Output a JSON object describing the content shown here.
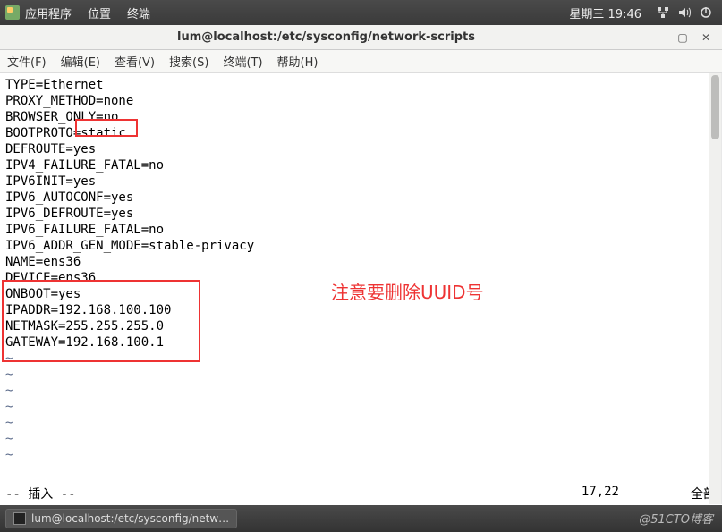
{
  "top_panel": {
    "menus": [
      "应用程序",
      "位置",
      "终端"
    ],
    "clock": "星期三 19:46"
  },
  "window": {
    "title": "lum@localhost:/etc/sysconfig/network-scripts"
  },
  "menubar": {
    "items": [
      "文件(F)",
      "编辑(E)",
      "查看(V)",
      "搜索(S)",
      "终端(T)",
      "帮助(H)"
    ]
  },
  "editor": {
    "lines": [
      "TYPE=Ethernet",
      "PROXY_METHOD=none",
      "BROWSER_ONLY=no",
      "BOOTPROTO=static",
      "DEFROUTE=yes",
      "IPV4_FAILURE_FATAL=no",
      "IPV6INIT=yes",
      "IPV6_AUTOCONF=yes",
      "IPV6_DEFROUTE=yes",
      "IPV6_FAILURE_FATAL=no",
      "IPV6_ADDR_GEN_MODE=stable-privacy",
      "NAME=ens36",
      "DEVICE=ens36",
      "ONBOOT=yes",
      "IPADDR=192.168.100.100",
      "NETMASK=255.255.255.0",
      "GATEWAY=192.168.100.1"
    ],
    "annotation": "注意要删除UUID号",
    "status_mode": "-- 插入 --",
    "status_pos": "17,22",
    "status_scroll": "全部"
  },
  "taskbar": {
    "item": "lum@localhost:/etc/sysconfig/netw…"
  },
  "watermark": "@51CTO博客"
}
